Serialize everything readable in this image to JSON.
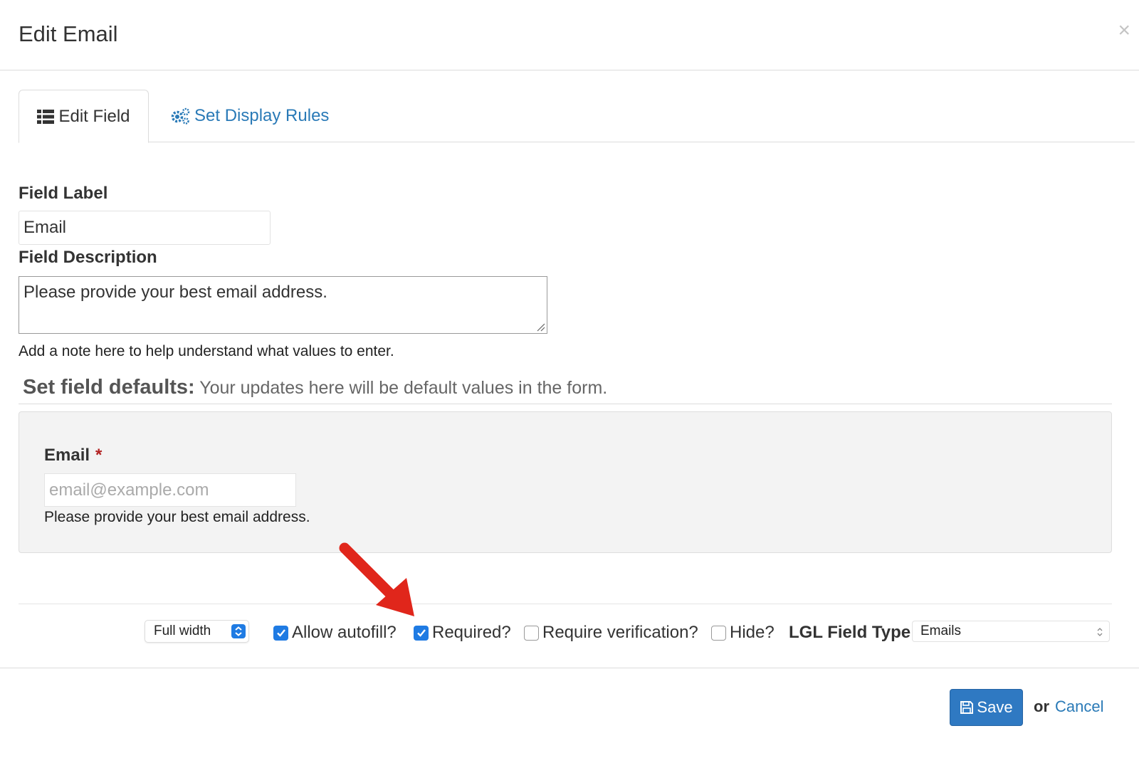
{
  "header": {
    "title": "Edit Email",
    "close_glyph": "×",
    "close_icon": "close-icon"
  },
  "tabs": [
    {
      "label": "Edit Field",
      "icon": "list-icon",
      "active": true
    },
    {
      "label": "Set Display Rules",
      "icon": "gears-icon",
      "active": false
    }
  ],
  "form": {
    "field_label": {
      "label": "Field Label",
      "value": "Email"
    },
    "field_description": {
      "label": "Field Description",
      "value": "Please provide your best email address.",
      "help": "Add a note here to help understand what values to enter."
    }
  },
  "defaults": {
    "heading_bold": "Set field defaults:",
    "heading_text": " Your updates here will be default values in the form.",
    "preview": {
      "label": "Email",
      "required_marker": "*",
      "placeholder": "email@example.com",
      "description": "Please provide your best email address."
    }
  },
  "options": {
    "width": {
      "selected": "Full width"
    },
    "allow_autofill": {
      "label": "Allow autofill?",
      "checked": true
    },
    "required": {
      "label": "Required?",
      "checked": true
    },
    "require_verification": {
      "label": "Require verification?",
      "checked": false
    },
    "hide": {
      "label": "Hide?",
      "checked": false
    },
    "field_type": {
      "label": "LGL Field Type:",
      "selected": "Emails"
    }
  },
  "footer": {
    "save_label": "Save",
    "save_icon": "floppy-disk-icon",
    "or_text": "or",
    "cancel_label": "Cancel"
  },
  "annotation": {
    "icon": "red-arrow-icon",
    "color": "#e0261b"
  },
  "colors": {
    "accent": "#1f7be3",
    "link": "#2a7ab7",
    "save_button": "#2f79c2"
  }
}
